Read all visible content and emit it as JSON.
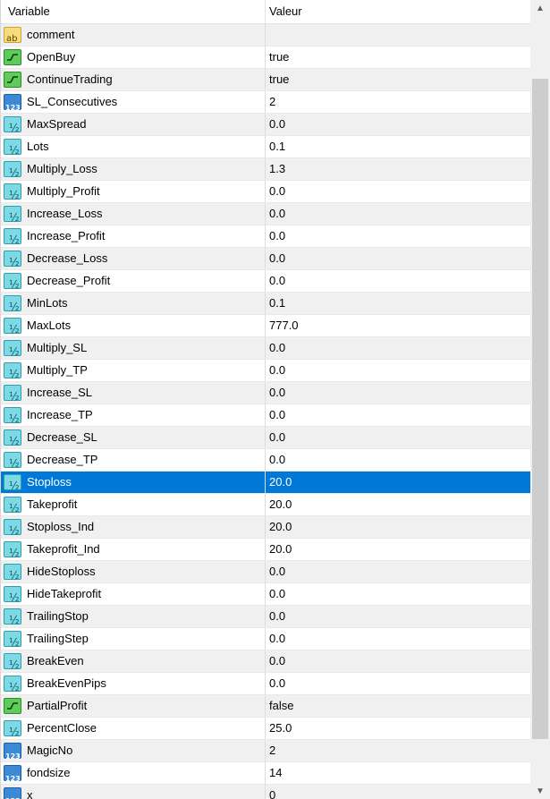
{
  "header": {
    "col_variable": "Variable",
    "col_value": "Valeur"
  },
  "rows": [
    {
      "type": "str",
      "icon": "string-icon",
      "name": "comment",
      "value": ""
    },
    {
      "type": "bool",
      "icon": "bool-icon",
      "name": "OpenBuy",
      "value": "true"
    },
    {
      "type": "bool",
      "icon": "bool-icon",
      "name": "ContinueTrading",
      "value": "true"
    },
    {
      "type": "int",
      "icon": "int-icon",
      "name": "SL_Consecutives",
      "value": "2"
    },
    {
      "type": "dbl",
      "icon": "double-icon",
      "name": "MaxSpread",
      "value": "0.0"
    },
    {
      "type": "dbl",
      "icon": "double-icon",
      "name": "Lots",
      "value": "0.1"
    },
    {
      "type": "dbl",
      "icon": "double-icon",
      "name": "Multiply_Loss",
      "value": "1.3"
    },
    {
      "type": "dbl",
      "icon": "double-icon",
      "name": "Multiply_Profit",
      "value": "0.0"
    },
    {
      "type": "dbl",
      "icon": "double-icon",
      "name": "Increase_Loss",
      "value": "0.0"
    },
    {
      "type": "dbl",
      "icon": "double-icon",
      "name": "Increase_Profit",
      "value": "0.0"
    },
    {
      "type": "dbl",
      "icon": "double-icon",
      "name": "Decrease_Loss",
      "value": "0.0"
    },
    {
      "type": "dbl",
      "icon": "double-icon",
      "name": "Decrease_Profit",
      "value": "0.0"
    },
    {
      "type": "dbl",
      "icon": "double-icon",
      "name": "MinLots",
      "value": "0.1"
    },
    {
      "type": "dbl",
      "icon": "double-icon",
      "name": "MaxLots",
      "value": "777.0"
    },
    {
      "type": "dbl",
      "icon": "double-icon",
      "name": "Multiply_SL",
      "value": "0.0"
    },
    {
      "type": "dbl",
      "icon": "double-icon",
      "name": "Multiply_TP",
      "value": "0.0"
    },
    {
      "type": "dbl",
      "icon": "double-icon",
      "name": "Increase_SL",
      "value": "0.0"
    },
    {
      "type": "dbl",
      "icon": "double-icon",
      "name": "Increase_TP",
      "value": "0.0"
    },
    {
      "type": "dbl",
      "icon": "double-icon",
      "name": "Decrease_SL",
      "value": "0.0"
    },
    {
      "type": "dbl",
      "icon": "double-icon",
      "name": "Decrease_TP",
      "value": "0.0"
    },
    {
      "type": "dbl",
      "icon": "double-icon",
      "name": "Stoploss",
      "value": "20.0",
      "selected": true
    },
    {
      "type": "dbl",
      "icon": "double-icon",
      "name": "Takeprofit",
      "value": "20.0"
    },
    {
      "type": "dbl",
      "icon": "double-icon",
      "name": "Stoploss_Ind",
      "value": "20.0"
    },
    {
      "type": "dbl",
      "icon": "double-icon",
      "name": "Takeprofit_Ind",
      "value": "20.0"
    },
    {
      "type": "dbl",
      "icon": "double-icon",
      "name": "HideStoploss",
      "value": "0.0"
    },
    {
      "type": "dbl",
      "icon": "double-icon",
      "name": "HideTakeprofit",
      "value": "0.0"
    },
    {
      "type": "dbl",
      "icon": "double-icon",
      "name": "TrailingStop",
      "value": "0.0"
    },
    {
      "type": "dbl",
      "icon": "double-icon",
      "name": "TrailingStep",
      "value": "0.0"
    },
    {
      "type": "dbl",
      "icon": "double-icon",
      "name": "BreakEven",
      "value": "0.0"
    },
    {
      "type": "dbl",
      "icon": "double-icon",
      "name": "BreakEvenPips",
      "value": "0.0"
    },
    {
      "type": "bool",
      "icon": "bool-icon",
      "name": "PartialProfit",
      "value": "false"
    },
    {
      "type": "dbl",
      "icon": "double-icon",
      "name": "PercentClose",
      "value": "25.0"
    },
    {
      "type": "int",
      "icon": "int-icon",
      "name": "MagicNo",
      "value": "2"
    },
    {
      "type": "int",
      "icon": "int-icon",
      "name": "fondsize",
      "value": "14"
    },
    {
      "type": "int",
      "icon": "int-icon",
      "name": "x",
      "value": "0"
    }
  ],
  "scrollbar": {
    "up_icon": "chevron-up-icon",
    "down_icon": "chevron-down-icon"
  }
}
